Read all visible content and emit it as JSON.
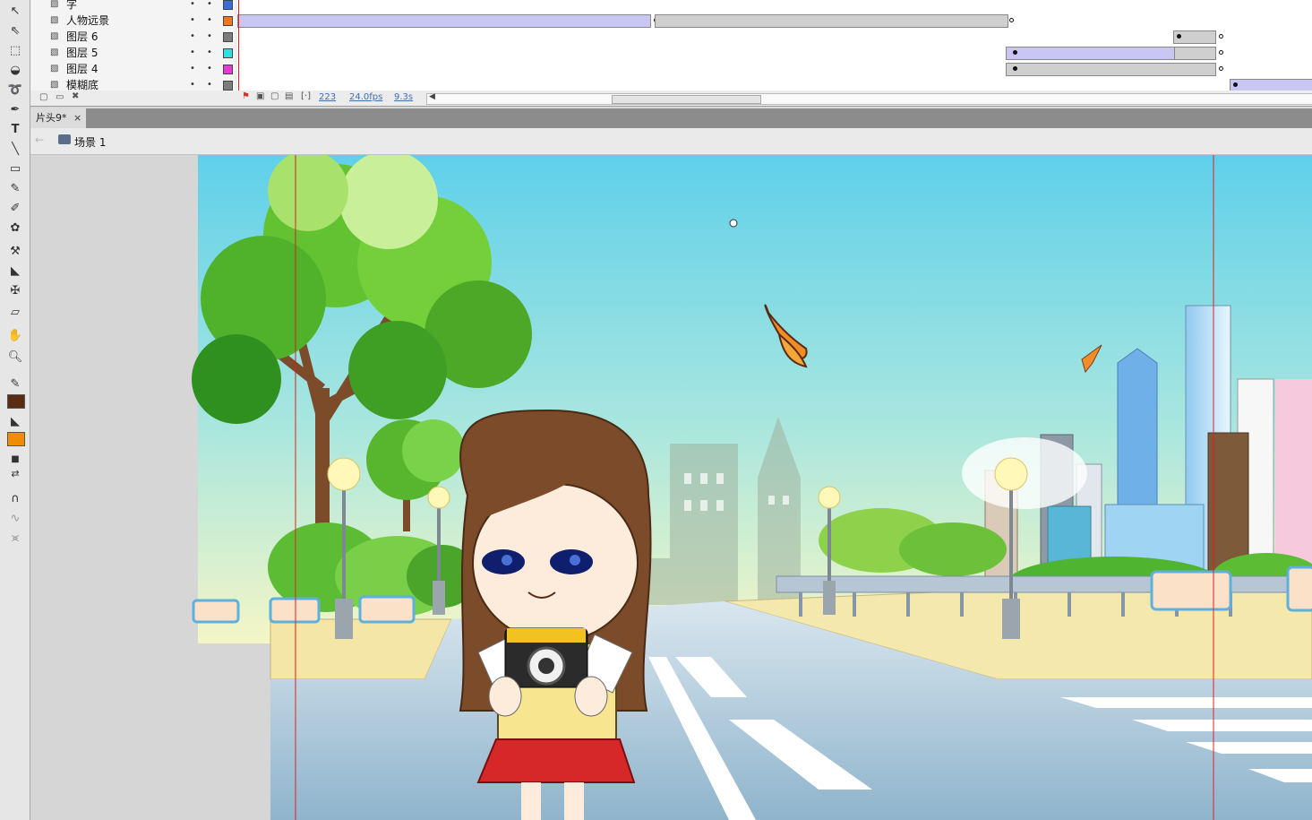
{
  "layers": [
    {
      "name": "字",
      "color": "#3a6bd6"
    },
    {
      "name": "人物远景",
      "color": "#f2761c"
    },
    {
      "name": "图层 6",
      "color": "#7c7c7c"
    },
    {
      "name": "图层 5",
      "color": "#2ee0e0"
    },
    {
      "name": "图层 4",
      "color": "#e63ad6"
    },
    {
      "name": "模糊底",
      "color": "#7c7c7c"
    }
  ],
  "timeline_footer": {
    "frame": "223",
    "fps": "24.0fps",
    "time": "9.3s"
  },
  "tab": {
    "label": "片头9*",
    "close": "×"
  },
  "breadcrumb": {
    "scene": "场景 1"
  },
  "colors": {
    "stroke": "#5a2c12",
    "fill": "#f08c00",
    "sky_top": "#5fd0ea",
    "sky_bottom": "#f4f6c6"
  }
}
